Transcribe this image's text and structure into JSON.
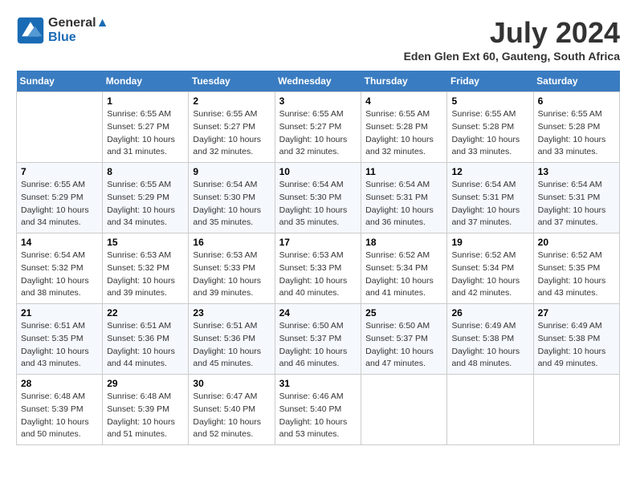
{
  "header": {
    "logo_line1": "General",
    "logo_line2": "Blue",
    "month_year": "July 2024",
    "location": "Eden Glen Ext 60, Gauteng, South Africa"
  },
  "days_of_week": [
    "Sunday",
    "Monday",
    "Tuesday",
    "Wednesday",
    "Thursday",
    "Friday",
    "Saturday"
  ],
  "weeks": [
    [
      {
        "day": "",
        "sunrise": "",
        "sunset": "",
        "daylight": ""
      },
      {
        "day": "1",
        "sunrise": "Sunrise: 6:55 AM",
        "sunset": "Sunset: 5:27 PM",
        "daylight": "Daylight: 10 hours and 31 minutes."
      },
      {
        "day": "2",
        "sunrise": "Sunrise: 6:55 AM",
        "sunset": "Sunset: 5:27 PM",
        "daylight": "Daylight: 10 hours and 32 minutes."
      },
      {
        "day": "3",
        "sunrise": "Sunrise: 6:55 AM",
        "sunset": "Sunset: 5:27 PM",
        "daylight": "Daylight: 10 hours and 32 minutes."
      },
      {
        "day": "4",
        "sunrise": "Sunrise: 6:55 AM",
        "sunset": "Sunset: 5:28 PM",
        "daylight": "Daylight: 10 hours and 32 minutes."
      },
      {
        "day": "5",
        "sunrise": "Sunrise: 6:55 AM",
        "sunset": "Sunset: 5:28 PM",
        "daylight": "Daylight: 10 hours and 33 minutes."
      },
      {
        "day": "6",
        "sunrise": "Sunrise: 6:55 AM",
        "sunset": "Sunset: 5:28 PM",
        "daylight": "Daylight: 10 hours and 33 minutes."
      }
    ],
    [
      {
        "day": "7",
        "sunrise": "Sunrise: 6:55 AM",
        "sunset": "Sunset: 5:29 PM",
        "daylight": "Daylight: 10 hours and 34 minutes."
      },
      {
        "day": "8",
        "sunrise": "Sunrise: 6:55 AM",
        "sunset": "Sunset: 5:29 PM",
        "daylight": "Daylight: 10 hours and 34 minutes."
      },
      {
        "day": "9",
        "sunrise": "Sunrise: 6:54 AM",
        "sunset": "Sunset: 5:30 PM",
        "daylight": "Daylight: 10 hours and 35 minutes."
      },
      {
        "day": "10",
        "sunrise": "Sunrise: 6:54 AM",
        "sunset": "Sunset: 5:30 PM",
        "daylight": "Daylight: 10 hours and 35 minutes."
      },
      {
        "day": "11",
        "sunrise": "Sunrise: 6:54 AM",
        "sunset": "Sunset: 5:31 PM",
        "daylight": "Daylight: 10 hours and 36 minutes."
      },
      {
        "day": "12",
        "sunrise": "Sunrise: 6:54 AM",
        "sunset": "Sunset: 5:31 PM",
        "daylight": "Daylight: 10 hours and 37 minutes."
      },
      {
        "day": "13",
        "sunrise": "Sunrise: 6:54 AM",
        "sunset": "Sunset: 5:31 PM",
        "daylight": "Daylight: 10 hours and 37 minutes."
      }
    ],
    [
      {
        "day": "14",
        "sunrise": "Sunrise: 6:54 AM",
        "sunset": "Sunset: 5:32 PM",
        "daylight": "Daylight: 10 hours and 38 minutes."
      },
      {
        "day": "15",
        "sunrise": "Sunrise: 6:53 AM",
        "sunset": "Sunset: 5:32 PM",
        "daylight": "Daylight: 10 hours and 39 minutes."
      },
      {
        "day": "16",
        "sunrise": "Sunrise: 6:53 AM",
        "sunset": "Sunset: 5:33 PM",
        "daylight": "Daylight: 10 hours and 39 minutes."
      },
      {
        "day": "17",
        "sunrise": "Sunrise: 6:53 AM",
        "sunset": "Sunset: 5:33 PM",
        "daylight": "Daylight: 10 hours and 40 minutes."
      },
      {
        "day": "18",
        "sunrise": "Sunrise: 6:52 AM",
        "sunset": "Sunset: 5:34 PM",
        "daylight": "Daylight: 10 hours and 41 minutes."
      },
      {
        "day": "19",
        "sunrise": "Sunrise: 6:52 AM",
        "sunset": "Sunset: 5:34 PM",
        "daylight": "Daylight: 10 hours and 42 minutes."
      },
      {
        "day": "20",
        "sunrise": "Sunrise: 6:52 AM",
        "sunset": "Sunset: 5:35 PM",
        "daylight": "Daylight: 10 hours and 43 minutes."
      }
    ],
    [
      {
        "day": "21",
        "sunrise": "Sunrise: 6:51 AM",
        "sunset": "Sunset: 5:35 PM",
        "daylight": "Daylight: 10 hours and 43 minutes."
      },
      {
        "day": "22",
        "sunrise": "Sunrise: 6:51 AM",
        "sunset": "Sunset: 5:36 PM",
        "daylight": "Daylight: 10 hours and 44 minutes."
      },
      {
        "day": "23",
        "sunrise": "Sunrise: 6:51 AM",
        "sunset": "Sunset: 5:36 PM",
        "daylight": "Daylight: 10 hours and 45 minutes."
      },
      {
        "day": "24",
        "sunrise": "Sunrise: 6:50 AM",
        "sunset": "Sunset: 5:37 PM",
        "daylight": "Daylight: 10 hours and 46 minutes."
      },
      {
        "day": "25",
        "sunrise": "Sunrise: 6:50 AM",
        "sunset": "Sunset: 5:37 PM",
        "daylight": "Daylight: 10 hours and 47 minutes."
      },
      {
        "day": "26",
        "sunrise": "Sunrise: 6:49 AM",
        "sunset": "Sunset: 5:38 PM",
        "daylight": "Daylight: 10 hours and 48 minutes."
      },
      {
        "day": "27",
        "sunrise": "Sunrise: 6:49 AM",
        "sunset": "Sunset: 5:38 PM",
        "daylight": "Daylight: 10 hours and 49 minutes."
      }
    ],
    [
      {
        "day": "28",
        "sunrise": "Sunrise: 6:48 AM",
        "sunset": "Sunset: 5:39 PM",
        "daylight": "Daylight: 10 hours and 50 minutes."
      },
      {
        "day": "29",
        "sunrise": "Sunrise: 6:48 AM",
        "sunset": "Sunset: 5:39 PM",
        "daylight": "Daylight: 10 hours and 51 minutes."
      },
      {
        "day": "30",
        "sunrise": "Sunrise: 6:47 AM",
        "sunset": "Sunset: 5:40 PM",
        "daylight": "Daylight: 10 hours and 52 minutes."
      },
      {
        "day": "31",
        "sunrise": "Sunrise: 6:46 AM",
        "sunset": "Sunset: 5:40 PM",
        "daylight": "Daylight: 10 hours and 53 minutes."
      },
      {
        "day": "",
        "sunrise": "",
        "sunset": "",
        "daylight": ""
      },
      {
        "day": "",
        "sunrise": "",
        "sunset": "",
        "daylight": ""
      },
      {
        "day": "",
        "sunrise": "",
        "sunset": "",
        "daylight": ""
      }
    ]
  ]
}
